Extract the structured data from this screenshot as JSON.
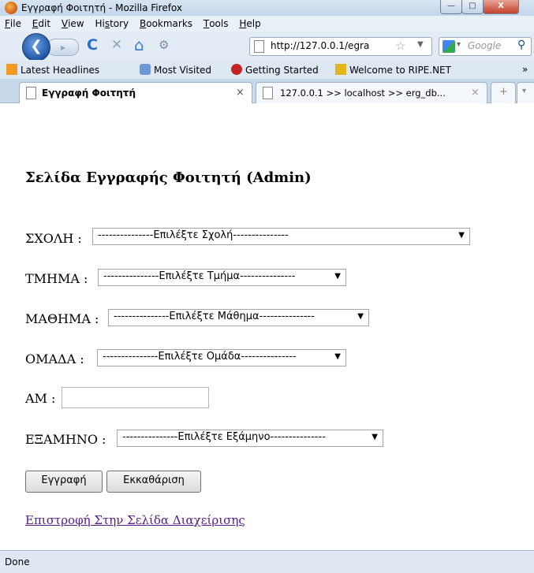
{
  "window": {
    "title": "Εγγραφή Φοιτητή - Mozilla Firefox",
    "minimize_glyph": "—",
    "maximize_glyph": "□",
    "close_glyph": "X"
  },
  "menu": [
    {
      "label": "File",
      "u": "F",
      "rest": "ile"
    },
    {
      "label": "Edit",
      "u": "E",
      "rest": "dit"
    },
    {
      "label": "View",
      "u": "V",
      "rest": "iew"
    },
    {
      "label": "History",
      "u": "",
      "pre": "Hi",
      "mid": "s",
      "post": "tory"
    },
    {
      "label": "Bookmarks",
      "u": "B",
      "rest": "ookmarks"
    },
    {
      "label": "Tools",
      "u": "T",
      "rest": "ools"
    },
    {
      "label": "Help",
      "u": "H",
      "rest": "elp"
    }
  ],
  "nav": {
    "back_glyph": "❮",
    "forward_glyph": "▸",
    "reload_glyph": "C",
    "stop_glyph": "✕",
    "home_glyph": "⌂",
    "url": "http://127.0.0.1/egra",
    "search_placeholder": "Google"
  },
  "bookmarks": [
    "Latest Headlines",
    "Most Visited",
    "Getting Started",
    "Welcome to RIPE.NET"
  ],
  "bookmarks_more": "»",
  "tabs": [
    {
      "label": "Εγγραφή Φοιτητή",
      "close": "×"
    },
    {
      "label": "127.0.0.1 >> localhost >> erg_db...",
      "close": "×"
    }
  ],
  "tab_add": "+",
  "page": {
    "heading": "Σελίδα Εγγραφής Φοιτητή (Admin)",
    "fields": [
      {
        "label": "ΣΧΟΛΗ :",
        "selected": "---------------Επιλέξτε Σχολή---------------"
      },
      {
        "label": "ΤΜΗΜΑ :",
        "selected": "---------------Επιλέξτε Τμήμα---------------"
      },
      {
        "label": "ΜΑΘΗΜΑ :",
        "selected": "---------------Επιλέξτε Μάθημα---------------"
      },
      {
        "label": "ΟΜΑΔΑ :",
        "selected": "---------------Επιλέξτε Ομάδα---------------"
      }
    ],
    "am_label": "ΑΜ :",
    "am_value": "",
    "semester": {
      "label": "ΕΞΑΜΗΝΟ :",
      "selected": "---------------Επιλέξτε Εξάμηνο---------------"
    },
    "submit_label": "Εγγραφή",
    "clear_label": "Εκκαθάριση",
    "back_link": "Επιστροφή Στην Σελίδα Διαχείρισης"
  },
  "status": "Done"
}
